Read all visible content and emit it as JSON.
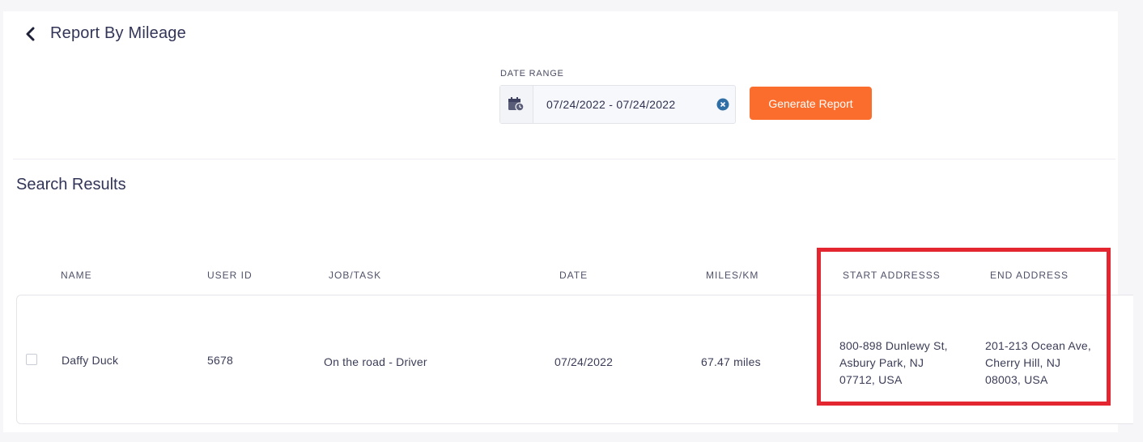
{
  "header": {
    "title": "Report By Mileage"
  },
  "filter": {
    "date_range_label": "DATE RANGE",
    "date_range_value": "07/24/2022 - 07/24/2022",
    "generate_label": "Generate Report"
  },
  "results": {
    "title": "Search Results",
    "columns": [
      "NAME",
      "USER ID",
      "JOB/TASK",
      "DATE",
      "MILES/KM",
      "START ADDRESSS",
      "END ADDRESS"
    ],
    "rows": [
      {
        "name": "Daffy Duck",
        "user_id": "5678",
        "job_task": "On the road - Driver",
        "date": "07/24/2022",
        "miles": "67.47 miles",
        "start_address": [
          "800-898 Dunlewy St,",
          "Asbury Park, NJ",
          "07712, USA"
        ],
        "end_address": [
          "201-213 Ocean Ave,",
          "Cherry Hill, NJ",
          "08003, USA"
        ]
      }
    ]
  },
  "colors": {
    "accent": "#fb6d2d",
    "highlight": "#e3262f",
    "clear_icon": "#2f6fa6",
    "text": "#3d3f5c"
  },
  "icons": {
    "back": "chevron-left-icon",
    "calendar": "calendar-clock-icon",
    "clear": "clear-x-icon"
  }
}
